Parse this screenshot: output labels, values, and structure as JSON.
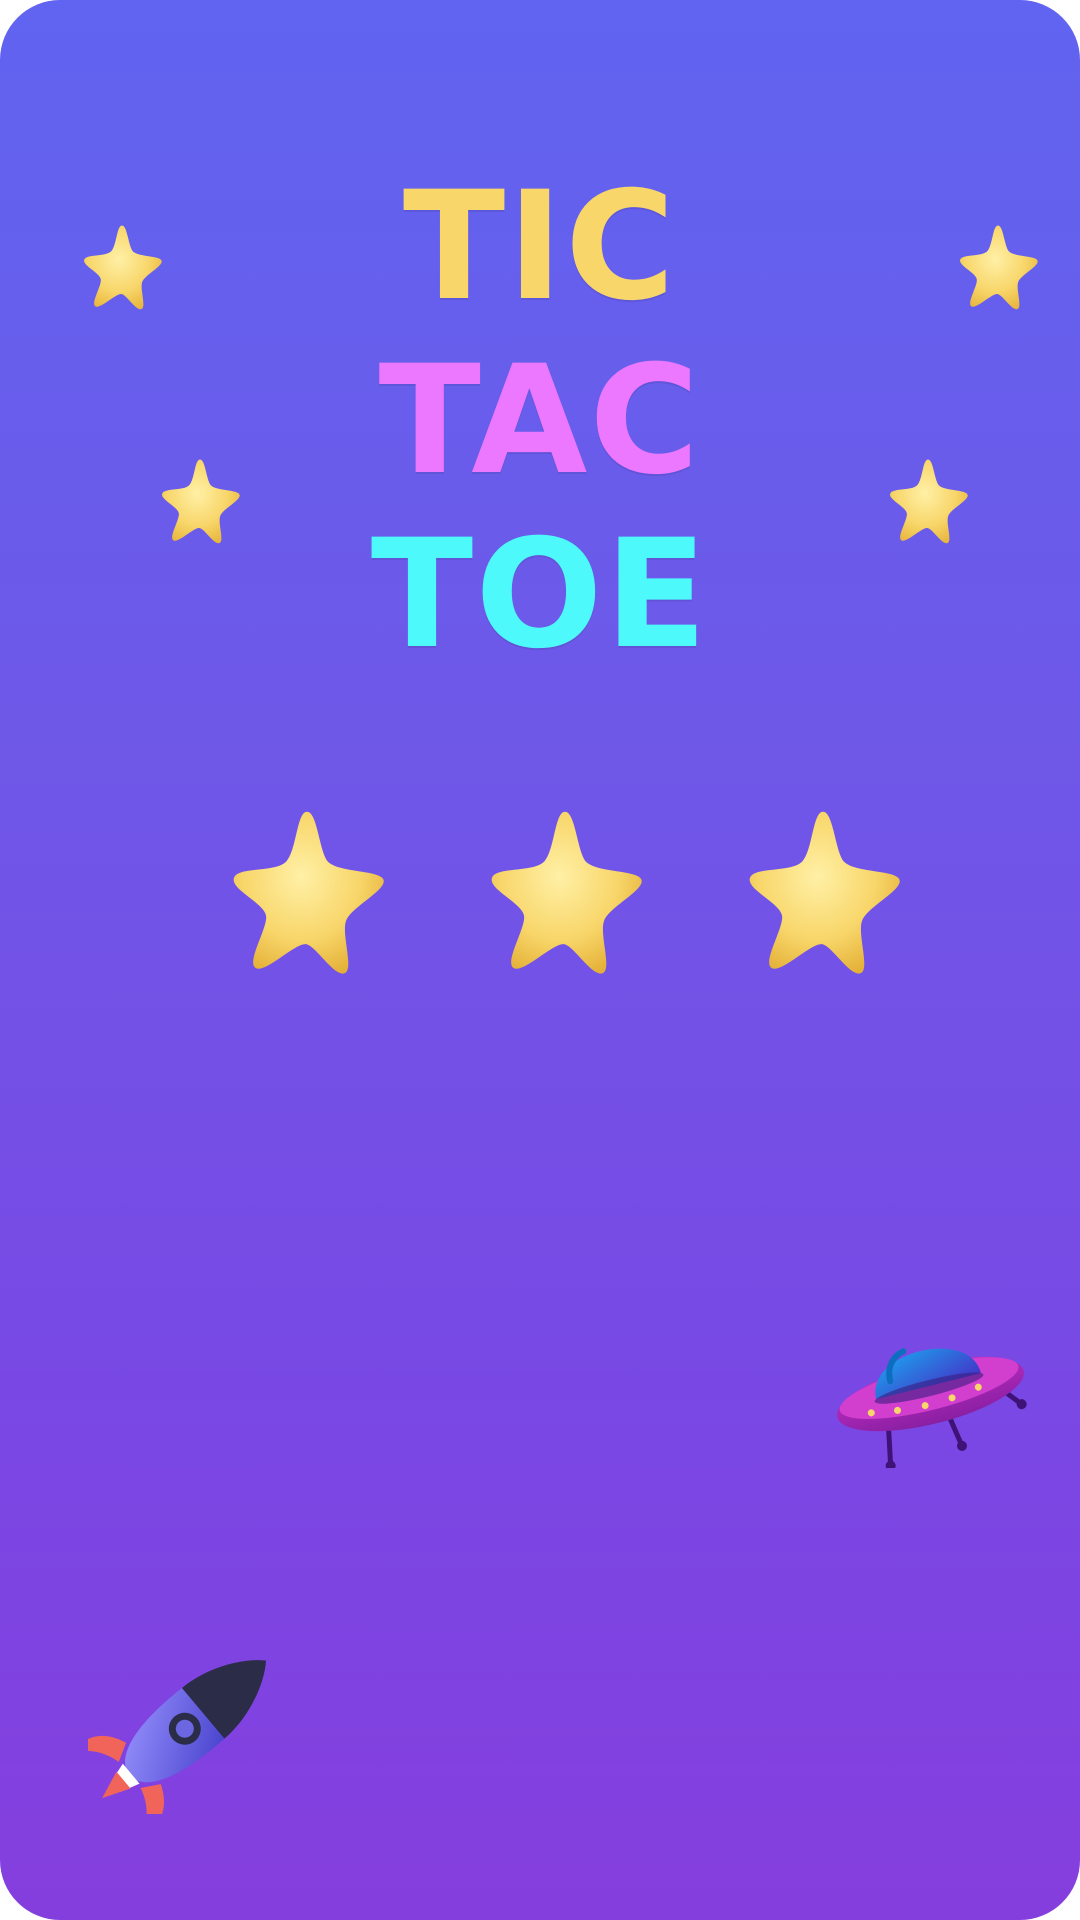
{
  "title": {
    "line1": "TIC",
    "line2": "TAC",
    "line3": "TOE"
  },
  "rating": {
    "stars_earned": 3,
    "stars_total": 3
  },
  "colors": {
    "background_top": "#6064f0",
    "background_bottom": "#853ede",
    "tic": "#f8d66a",
    "tac": "#ec78ff",
    "toe": "#4ef9fc",
    "star": "#f8d66a"
  },
  "icons": {
    "decorative_stars": "star-icon",
    "ufo": "ufo-icon",
    "rocket": "rocket-icon"
  }
}
